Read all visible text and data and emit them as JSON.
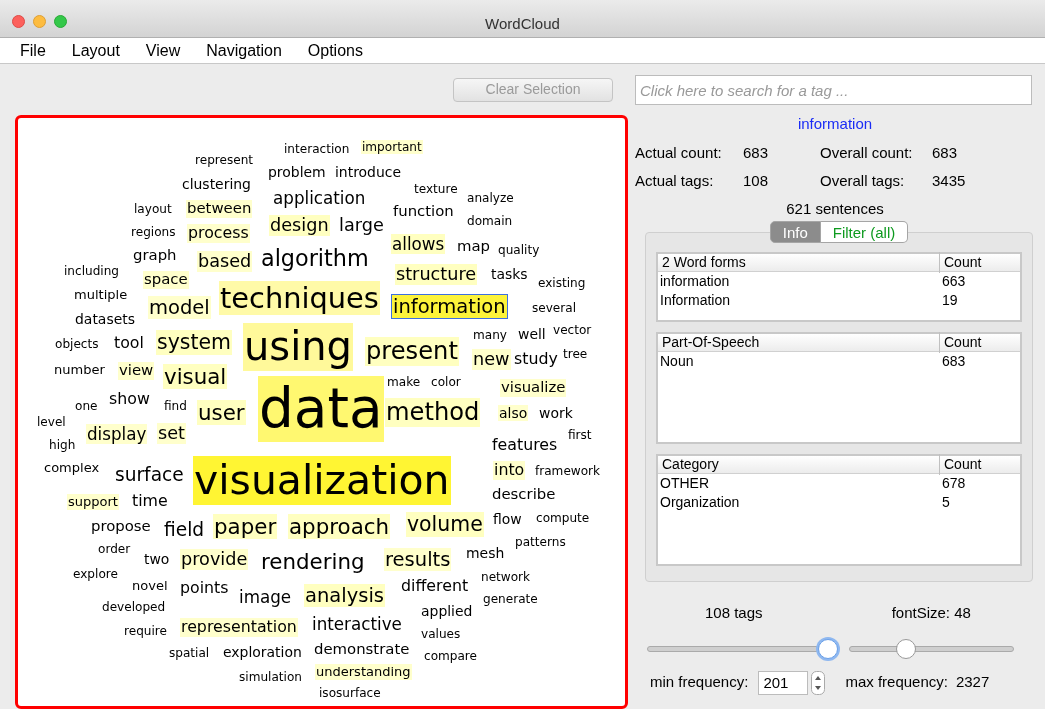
{
  "window": {
    "title": "WordCloud"
  },
  "menu": [
    "File",
    "Layout",
    "View",
    "Navigation",
    "Options"
  ],
  "clear_button": {
    "label": "Clear Selection",
    "disabled": true
  },
  "search": {
    "placeholder": "Click here to search for a tag ..."
  },
  "cloud": {
    "words": [
      {
        "text": "interaction"
      },
      {
        "text": "important",
        "color": "#ffffcc"
      },
      {
        "text": "represent"
      },
      {
        "text": "problem"
      },
      {
        "text": "introduce"
      },
      {
        "text": "clustering"
      },
      {
        "text": "texture"
      },
      {
        "text": "application"
      },
      {
        "text": "analyze"
      },
      {
        "text": "layout"
      },
      {
        "text": "between",
        "color": "#ffffcc"
      },
      {
        "text": "function"
      },
      {
        "text": "design",
        "color": "#ffffc0"
      },
      {
        "text": "large"
      },
      {
        "text": "domain"
      },
      {
        "text": "regions"
      },
      {
        "text": "process",
        "color": "#ffffcc"
      },
      {
        "text": "graph"
      },
      {
        "text": "based",
        "color": "#ffffcc"
      },
      {
        "text": "algorithm"
      },
      {
        "text": "allows",
        "color": "#ffffc0"
      },
      {
        "text": "map"
      },
      {
        "text": "quality"
      },
      {
        "text": "including"
      },
      {
        "text": "space",
        "color": "#ffffcc"
      },
      {
        "text": "structure",
        "color": "#ffffc0"
      },
      {
        "text": "tasks"
      },
      {
        "text": "existing"
      },
      {
        "text": "multiple"
      },
      {
        "text": "model",
        "color": "#ffffcc"
      },
      {
        "text": "techniques",
        "color": "#fffaa8"
      },
      {
        "text": "information",
        "color": "#fcf33a",
        "selected": true
      },
      {
        "text": "several"
      },
      {
        "text": "datasets"
      },
      {
        "text": "objects"
      },
      {
        "text": "tool"
      },
      {
        "text": "system",
        "color": "#ffffc0"
      },
      {
        "text": "using",
        "color": "#fff99a"
      },
      {
        "text": "present",
        "color": "#ffffc0"
      },
      {
        "text": "many"
      },
      {
        "text": "well"
      },
      {
        "text": "vector"
      },
      {
        "text": "new",
        "color": "#ffffcc"
      },
      {
        "text": "study"
      },
      {
        "text": "tree"
      },
      {
        "text": "number"
      },
      {
        "text": "view",
        "color": "#ffffcc"
      },
      {
        "text": "visual",
        "color": "#ffffc0"
      },
      {
        "text": "make"
      },
      {
        "text": "color"
      },
      {
        "text": "visualize",
        "color": "#ffffcc"
      },
      {
        "text": "one"
      },
      {
        "text": "show"
      },
      {
        "text": "find"
      },
      {
        "text": "user",
        "color": "#ffffc0"
      },
      {
        "text": "data",
        "color": "#fff870"
      },
      {
        "text": "method",
        "color": "#ffffc0"
      },
      {
        "text": "also",
        "color": "#ffffcc"
      },
      {
        "text": "work"
      },
      {
        "text": "level"
      },
      {
        "text": "display",
        "color": "#ffffcc"
      },
      {
        "text": "set",
        "color": "#ffffcc"
      },
      {
        "text": "first"
      },
      {
        "text": "high"
      },
      {
        "text": "features"
      },
      {
        "text": "complex"
      },
      {
        "text": "surface"
      },
      {
        "text": "visualization",
        "color": "#fff533"
      },
      {
        "text": "into",
        "color": "#ffffcc"
      },
      {
        "text": "framework"
      },
      {
        "text": "support",
        "color": "#ffffcc"
      },
      {
        "text": "time"
      },
      {
        "text": "describe"
      },
      {
        "text": "propose"
      },
      {
        "text": "field"
      },
      {
        "text": "paper",
        "color": "#ffffc0"
      },
      {
        "text": "approach",
        "color": "#ffffc0"
      },
      {
        "text": "volume",
        "color": "#ffffc0"
      },
      {
        "text": "flow"
      },
      {
        "text": "compute"
      },
      {
        "text": "order"
      },
      {
        "text": "patterns"
      },
      {
        "text": "two"
      },
      {
        "text": "provide",
        "color": "#ffffcc"
      },
      {
        "text": "rendering"
      },
      {
        "text": "results",
        "color": "#ffffcc"
      },
      {
        "text": "mesh"
      },
      {
        "text": "explore"
      },
      {
        "text": "network"
      },
      {
        "text": "novel"
      },
      {
        "text": "points"
      },
      {
        "text": "image"
      },
      {
        "text": "analysis",
        "color": "#ffffc0"
      },
      {
        "text": "different"
      },
      {
        "text": "generate"
      },
      {
        "text": "developed"
      },
      {
        "text": "applied"
      },
      {
        "text": "require"
      },
      {
        "text": "representation",
        "color": "#ffffcc"
      },
      {
        "text": "interactive"
      },
      {
        "text": "values"
      },
      {
        "text": "spatial"
      },
      {
        "text": "exploration"
      },
      {
        "text": "demonstrate"
      },
      {
        "text": "compare"
      },
      {
        "text": "simulation"
      },
      {
        "text": "understanding",
        "color": "#ffffcc"
      },
      {
        "text": "isosurface"
      }
    ]
  },
  "selected_tag": "information",
  "stats": [
    {
      "label": "Actual count:",
      "value": "683"
    },
    {
      "label": "Overall count:",
      "value": "683"
    },
    {
      "label": "Actual tags:",
      "value": "108"
    },
    {
      "label": "Overall tags:",
      "value": "3435"
    }
  ],
  "sentences": "621 sentences",
  "tabs": [
    {
      "label": "Info",
      "selected": true
    },
    {
      "label": "Filter (all)",
      "selected": false
    }
  ],
  "tables": [
    {
      "columns": [
        "2 Word forms",
        "Count"
      ],
      "rows": [
        [
          "information",
          "663"
        ],
        [
          "Information",
          "19"
        ]
      ]
    },
    {
      "columns": [
        "Part-Of-Speech",
        "Count"
      ],
      "rows": [
        [
          "Noun",
          "683"
        ]
      ]
    },
    {
      "columns": [
        "Category",
        "Count"
      ],
      "rows": [
        [
          "OTHER",
          "678"
        ],
        [
          "Organization",
          "5"
        ]
      ]
    }
  ],
  "sliders": [
    {
      "label": "108 tags",
      "level": 0.95,
      "focused": true
    },
    {
      "label": "fontSize: 48",
      "level": 0.35,
      "focused": false
    }
  ],
  "min_frequency": {
    "label": "min frequency:",
    "value": "201"
  },
  "max_frequency": {
    "label": "max frequency:",
    "value": "2327"
  }
}
